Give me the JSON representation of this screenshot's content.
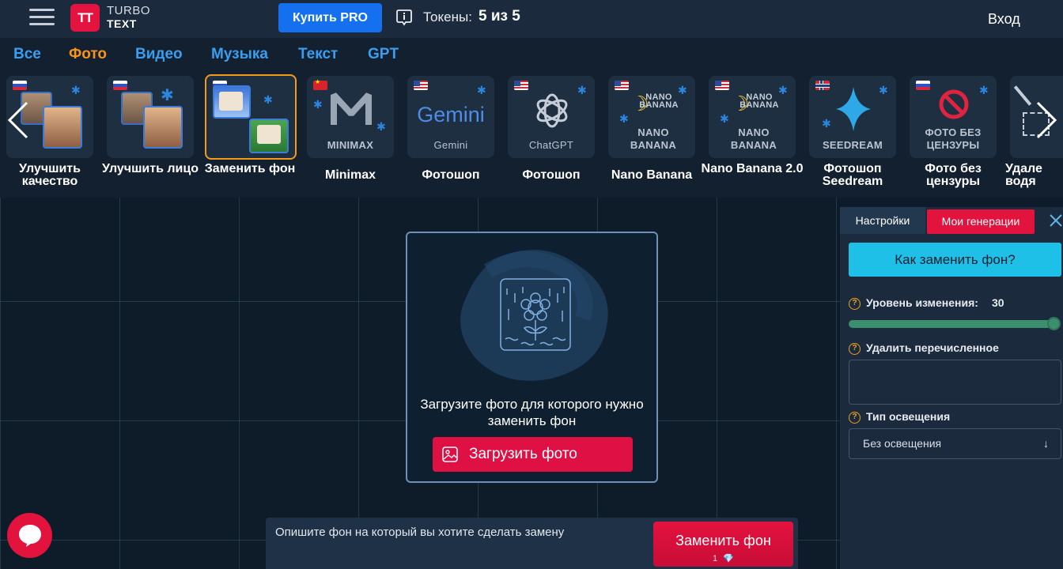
{
  "header": {
    "logo_mark": "TT",
    "logo_top": "TURBO",
    "logo_bottom": "TEXT",
    "buy_pro": "Купить PRO",
    "tokens_label": "Токены:",
    "tokens_value": "5 из 5",
    "login": "Вход",
    "accent_color": "#1570ef",
    "brand_color": "#e5133f"
  },
  "categories": [
    {
      "label": "Все",
      "active": false
    },
    {
      "label": "Фото",
      "active": true
    },
    {
      "label": "Видео",
      "active": false
    },
    {
      "label": "Музыка",
      "active": false
    },
    {
      "label": "Текст",
      "active": false
    },
    {
      "label": "GPT",
      "active": false
    }
  ],
  "tools": [
    {
      "label": "Улучшить качество",
      "flag": "ru",
      "thumb_caption": ""
    },
    {
      "label": "Улучшить лицо",
      "flag": "ru",
      "thumb_caption": ""
    },
    {
      "label": "Заменить фон",
      "flag": "ru",
      "thumb_caption": "",
      "active": true
    },
    {
      "label": "Minimax",
      "flag": "cn",
      "thumb_caption": "MINIMAX"
    },
    {
      "label": "Фотошоп",
      "flag": "us",
      "thumb_caption": "Gemini"
    },
    {
      "label": "Фотошоп",
      "flag": "us",
      "thumb_caption": "ChatGPT"
    },
    {
      "label": "Nano Banana",
      "flag": "us",
      "thumb_caption": "NANO BANANA",
      "thumb_caption_top": "NANO BANANA"
    },
    {
      "label": "Nano Banana 2.0",
      "flag": "us",
      "thumb_caption": "NANO BANANA",
      "thumb_caption_top": "NANO BANANA"
    },
    {
      "label": "Фотошоп Seedream",
      "flag": "no",
      "thumb_caption": "SEEDREAM"
    },
    {
      "label": "Фото без цензуры",
      "flag": "ru",
      "thumb_caption": "ФОТО БЕЗ ЦЕНЗУРЫ"
    },
    {
      "label": "Удале водя",
      "flag": "",
      "thumb_caption": ""
    }
  ],
  "thumb_brand": {
    "gemini": "Gemini",
    "chatgpt": "ChatGPT"
  },
  "upload": {
    "text": "Загрузите фото для которого нужно заменить фон",
    "button": "Загрузить фото"
  },
  "prompt": {
    "placeholder": "Опишите фон на который вы хотите сделать замену",
    "submit": "Заменить фон",
    "cost": "1",
    "cost_icon": "diamond-icon"
  },
  "panel": {
    "tab_settings": "Настройки",
    "tab_generations": "Мои генерации",
    "how_button": "Как заменить фон?",
    "change_level_label": "Уровень изменения:",
    "change_level_value": "30",
    "change_level_fraction": 1.0,
    "remove_label": "Удалить перечисленное",
    "remove_value": "",
    "lighting_label": "Тип освещения",
    "lighting_value": "Без освещения",
    "help_glyph": "?"
  }
}
